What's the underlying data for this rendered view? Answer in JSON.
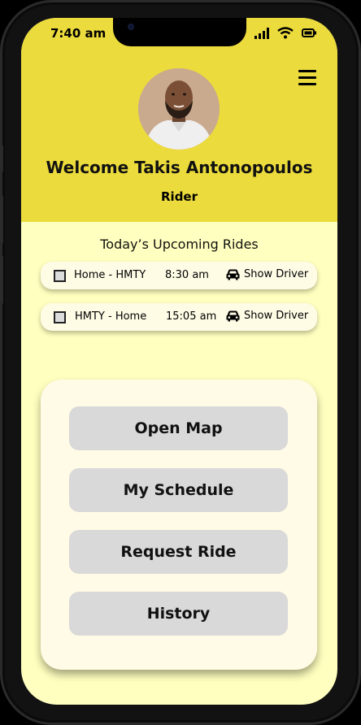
{
  "status_bar": {
    "time": "7:40 am"
  },
  "header": {
    "welcome_text": "Welcome Takis Antonopoulos",
    "role": "Rider",
    "menu_icon": "hamburger-menu-icon"
  },
  "rides": {
    "title": "Today’s Upcoming Rides",
    "items": [
      {
        "route": "Home - HMTY",
        "time": "8:30 am",
        "action": "Show Driver",
        "icon": "car-icon"
      },
      {
        "route": "HMTY - Home",
        "time": "15:05 am",
        "action": "Show Driver",
        "icon": "car-icon"
      }
    ]
  },
  "actions": {
    "open_map": "Open Map",
    "my_schedule": "My Schedule",
    "request_ride": "Request Ride",
    "history": "History"
  },
  "colors": {
    "header_bg": "#ecdb3c",
    "body_bg": "#ffffbf",
    "card_bg": "#fffbe6",
    "button_bg": "#d9d9d9"
  }
}
